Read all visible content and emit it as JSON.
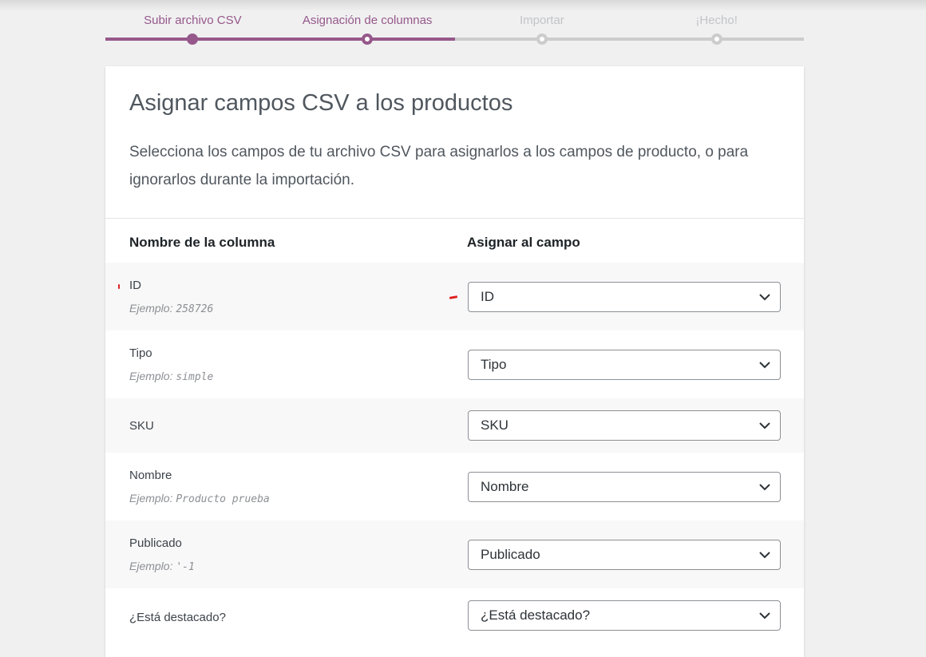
{
  "steps": [
    {
      "label": "Subir archivo CSV",
      "state": "done"
    },
    {
      "label": "Asignación de columnas",
      "state": "current"
    },
    {
      "label": "Importar",
      "state": "pending"
    },
    {
      "label": "¡Hecho!",
      "state": "pending"
    }
  ],
  "card": {
    "title": "Asignar campos CSV a los productos",
    "description": "Selecciona los campos de tu archivo CSV para asignarlos a los campos de producto, o para ignorarlos durante la importación."
  },
  "table": {
    "col_name_header": "Nombre de la columna",
    "col_map_header": "Asignar al campo",
    "rows": [
      {
        "name": "ID",
        "example_prefix": "Ejemplo:",
        "example_value": "258726",
        "mapped": "ID"
      },
      {
        "name": "Tipo",
        "example_prefix": "Ejemplo:",
        "example_value": "simple",
        "mapped": "Tipo"
      },
      {
        "name": "SKU",
        "mapped": "SKU"
      },
      {
        "name": "Nombre",
        "example_prefix": "Ejemplo:",
        "example_value": "Producto prueba",
        "mapped": "Nombre"
      },
      {
        "name": "Publicado",
        "example_prefix": "Ejemplo:",
        "example_value": "'-1",
        "mapped": "Publicado"
      },
      {
        "name": "¿Está destacado?",
        "mapped": "¿Está destacado?"
      }
    ]
  },
  "colors": {
    "accent": "#96588a",
    "inactive": "#cccccc",
    "marker": "#e02020"
  },
  "icons": {
    "select_arrow": "chevron-down-icon"
  }
}
